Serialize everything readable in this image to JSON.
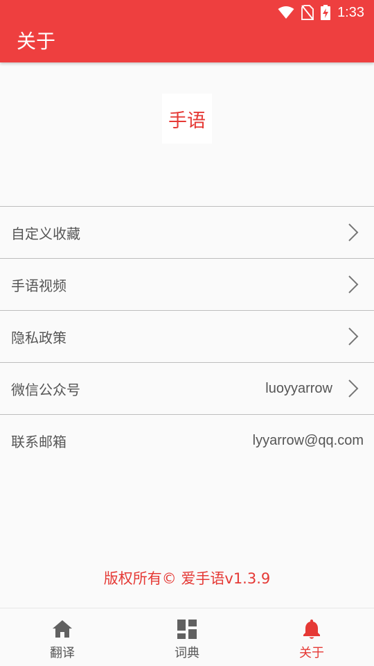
{
  "status": {
    "time": "1:33"
  },
  "header": {
    "title": "关于"
  },
  "logo": {
    "text": "手语"
  },
  "menu": [
    {
      "label": "自定义收藏",
      "value": "",
      "chevron": true
    },
    {
      "label": "手语视频",
      "value": "",
      "chevron": true
    },
    {
      "label": "隐私政策",
      "value": "",
      "chevron": true
    },
    {
      "label": "微信公众号",
      "value": "luoyyarrow",
      "chevron": true
    },
    {
      "label": "联系邮箱",
      "value": "lyyarrow@qq.com",
      "chevron": false
    }
  ],
  "footer": {
    "copyright": "版权所有© 爱手语v1.3.9"
  },
  "bottom_nav": [
    {
      "label": "翻译",
      "icon": "home-icon",
      "active": false
    },
    {
      "label": "词典",
      "icon": "dashboard-icon",
      "active": false
    },
    {
      "label": "关于",
      "icon": "bell-icon",
      "active": true
    }
  ],
  "colors": {
    "accent": "#ee3f3f",
    "accent_text": "#e53935"
  }
}
